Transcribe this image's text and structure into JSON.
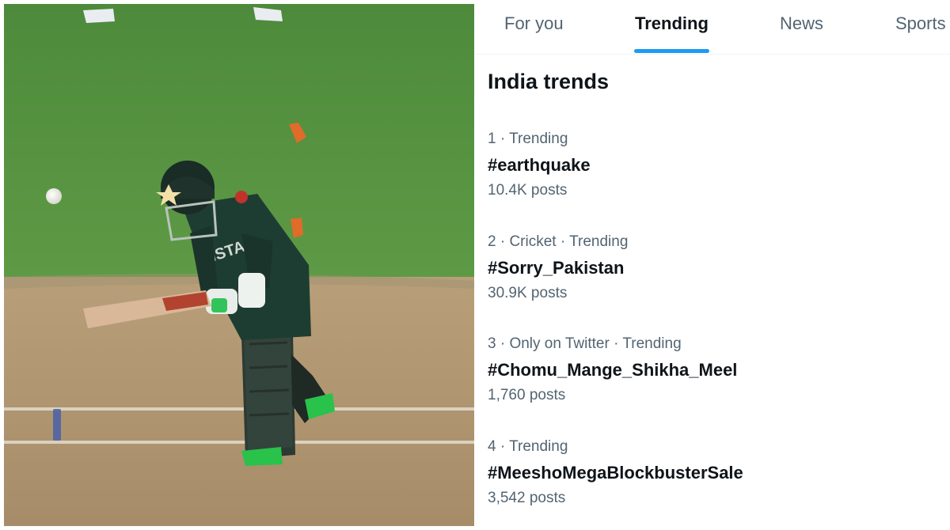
{
  "tabs": [
    {
      "label": "For you",
      "active": false
    },
    {
      "label": "Trending",
      "active": true
    },
    {
      "label": "News",
      "active": false
    },
    {
      "label": "Sports",
      "active": false
    }
  ],
  "panel": {
    "title": "India trends"
  },
  "trends": [
    {
      "meta": "1 · Trending",
      "name": "#earthquake",
      "count": "10.4K posts"
    },
    {
      "meta": "2 · Cricket · Trending",
      "name": "#Sorry_Pakistan",
      "count": "30.9K posts"
    },
    {
      "meta": "3 · Only on Twitter · Trending",
      "name": "#Chomu_Mange_Shikha_Meel",
      "count": "1,760 posts"
    },
    {
      "meta": "4 · Trending",
      "name": "#MeeshoMegaBlockbusterSale",
      "count": "3,542 posts"
    }
  ],
  "colors": {
    "accent": "#1d9bf0",
    "primary_text": "#0f1419",
    "secondary_text": "#536471"
  }
}
